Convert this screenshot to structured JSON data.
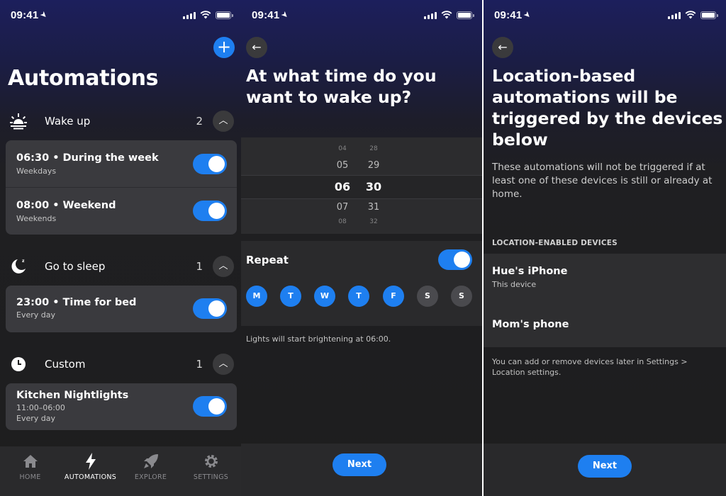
{
  "status": {
    "time": "09:41"
  },
  "automations": {
    "title": "Automations",
    "add_icon": "plus-icon",
    "sections": [
      {
        "label": "Wake up",
        "icon": "sunrise-icon",
        "count": "2",
        "items": [
          {
            "title": "06:30 • During the week",
            "subtitle": "Weekdays",
            "enabled": true
          },
          {
            "title": "08:00 • Weekend",
            "subtitle": "Weekends",
            "enabled": true
          }
        ]
      },
      {
        "label": "Go to sleep",
        "icon": "moon-zz-icon",
        "count": "1",
        "items": [
          {
            "title": "23:00 • Time for bed",
            "subtitle": "Every day",
            "enabled": true
          }
        ]
      },
      {
        "label": "Custom",
        "icon": "clock-icon",
        "count": "1",
        "items": [
          {
            "title": "Kitchen Nightlights",
            "subtitle": "11:00–06:00",
            "subtitle2": "Every day",
            "enabled": true
          }
        ]
      }
    ],
    "tabs": [
      {
        "label": "HOME",
        "icon": "home-icon",
        "active": false
      },
      {
        "label": "AUTOMATIONS",
        "icon": "bolt-icon",
        "active": true
      },
      {
        "label": "EXPLORE",
        "icon": "rocket-icon",
        "active": false
      },
      {
        "label": "SETTINGS",
        "icon": "gear-icon",
        "active": false
      }
    ]
  },
  "wake": {
    "title": "At what time do you want to wake up?",
    "picker": {
      "hours": [
        "04",
        "05",
        "06",
        "07",
        "08"
      ],
      "minutes": [
        "28",
        "29",
        "30",
        "31",
        "32"
      ],
      "selected_hour": "06",
      "selected_minute": "30"
    },
    "repeat_label": "Repeat",
    "repeat_enabled": true,
    "days": [
      {
        "label": "M",
        "on": true
      },
      {
        "label": "T",
        "on": true
      },
      {
        "label": "W",
        "on": true
      },
      {
        "label": "T",
        "on": true
      },
      {
        "label": "F",
        "on": true
      },
      {
        "label": "S",
        "on": false
      },
      {
        "label": "S",
        "on": false
      }
    ],
    "hint": "Lights will start brightening at 06:00.",
    "next_label": "Next"
  },
  "location": {
    "title": "Location-based automations will be triggered by the devices below",
    "description": "These automations will not be triggered if at least one of these devices is still or already at home.",
    "devices_header": "LOCATION-ENABLED DEVICES",
    "devices": [
      {
        "name": "Hue's iPhone",
        "subtitle": "This device"
      },
      {
        "name": "Mom's phone",
        "subtitle": ""
      }
    ],
    "note": "You can add or remove devices later in Settings > Location settings.",
    "next_label": "Next"
  },
  "colors": {
    "accent": "#1e7ff0",
    "card": "#3a3a3e",
    "background": "#1e1e1e"
  }
}
